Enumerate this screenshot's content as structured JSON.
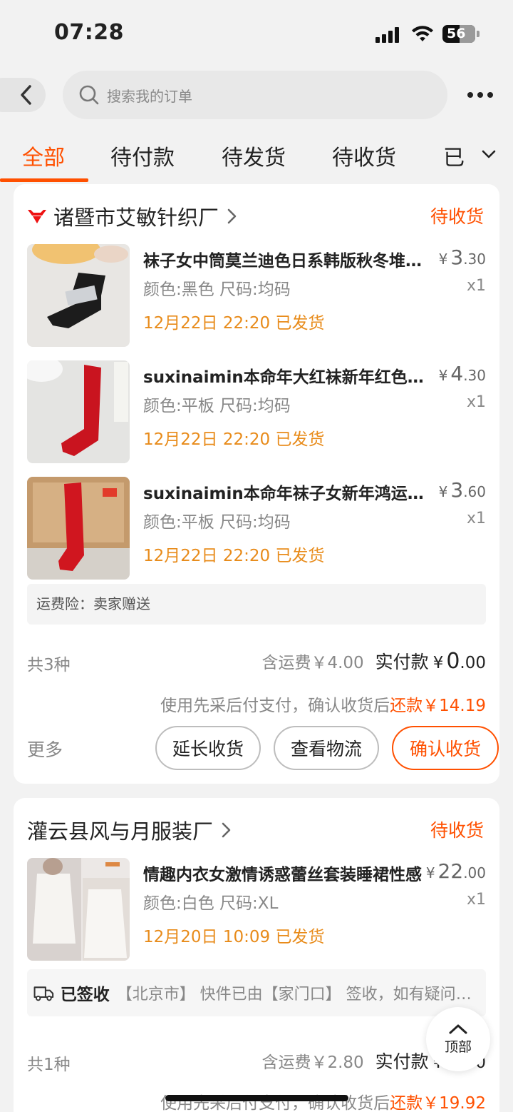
{
  "status_bar": {
    "time": "07:28",
    "battery": "56"
  },
  "search": {
    "placeholder": "搜索我的订单"
  },
  "tabs": [
    {
      "label": "全部",
      "active": true
    },
    {
      "label": "待付款"
    },
    {
      "label": "待发货"
    },
    {
      "label": "待收货"
    },
    {
      "label": "已"
    }
  ],
  "orders": [
    {
      "shop_name": "诸暨市艾敏针织厂",
      "status": "待收货",
      "items": [
        {
          "title": "袜子女中筒莫兰迪色日系韩版秋冬堆堆袜",
          "spec": "颜色:黑色 尺码:均码",
          "shipped": "12月22日 22:20 已发货",
          "price_int": "3",
          "price_dec": ".30",
          "qty": "x1"
        },
        {
          "title": "suxinaimin本命年大红袜新年红色中筒袜",
          "spec": "颜色:平板 尺码:均码",
          "shipped": "12月22日 22:20 已发货",
          "price_int": "4",
          "price_dec": ".30",
          "qty": "x1"
        },
        {
          "title": "suxinaimin本命年袜子女新年鸿运红袜子",
          "spec": "颜色:平板 尺码:均码",
          "shipped": "12月22日 22:20 已发货",
          "price_int": "3",
          "price_dec": ".60",
          "qty": "x1"
        }
      ],
      "insurance": "运费险：卖家赠送",
      "count": "共3种",
      "shipping_fee": "含运费￥4.00",
      "paid_label": "实付款",
      "paid_int": "0",
      "paid_dec": ".00",
      "paylater_text": "使用先采后付支付，确认收货后",
      "repay_text": "还款￥14.19",
      "more_label": "更多",
      "buttons": [
        "延长收货",
        "查看物流",
        "确认收货"
      ]
    },
    {
      "shop_name": "灌云县风与月服装厂",
      "status": "待收货",
      "items": [
        {
          "title": "情趣内衣女激情诱惑蕾丝套装睡裙性感",
          "spec": "颜色:白色 尺码:XL",
          "shipped": "12月20日 10:09 已发货",
          "price_int": "22",
          "price_dec": ".00",
          "qty": "x1"
        }
      ],
      "logistics_status": "已签收",
      "logistics_text": "【北京市】 快件已由【家门口】 签收，如有疑问请联系快递员",
      "count": "共1种",
      "shipping_fee": "含运费￥2.80",
      "paid_label": "实付款",
      "paid_int": "0",
      "paid_dec": ".00",
      "paylater_text": "使用先采后付支付，确认收货后",
      "repay_text": "还款￥19.92"
    }
  ],
  "top_button": {
    "label": "顶部"
  },
  "colors": {
    "accent": "#ff5000",
    "ship_date": "#e88b1a"
  }
}
